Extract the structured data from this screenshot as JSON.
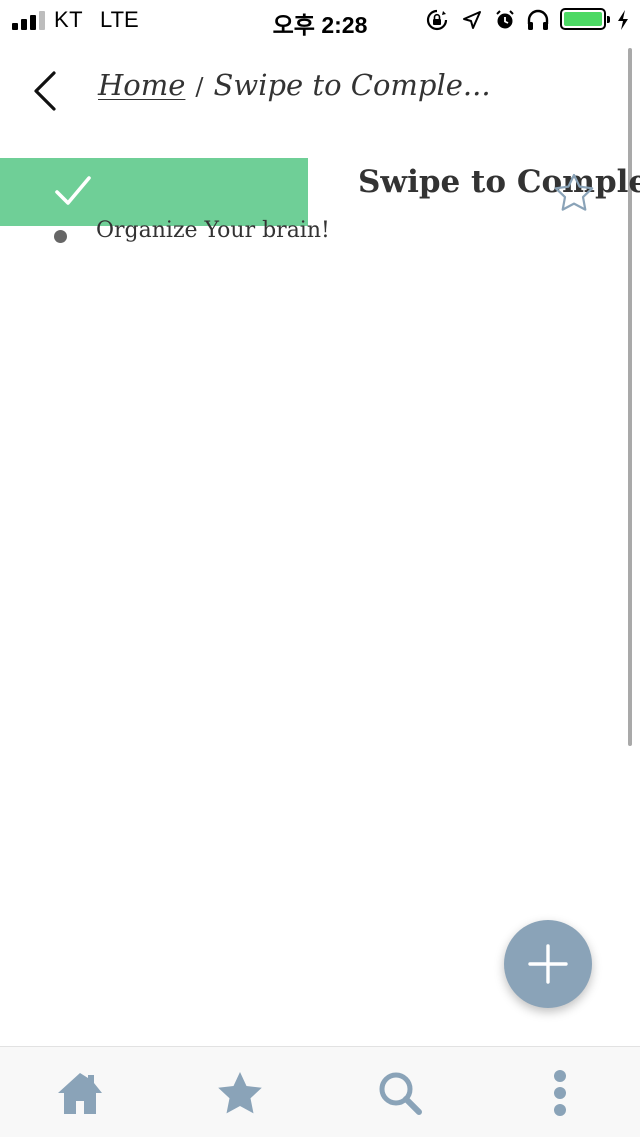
{
  "status_bar": {
    "carrier": "KT",
    "network": "LTE",
    "time": "오후 2:28",
    "battery_color": "#4cd964"
  },
  "header": {
    "back_icon": "chevron-left-icon",
    "breadcrumb": {
      "home": "Home",
      "separator": "/",
      "current": "Swipe to Comple..."
    }
  },
  "page": {
    "title": "Swipe to Complet",
    "star_icon": "star-outline-icon",
    "swipe_action_color": "#6fcf97",
    "items": [
      {
        "text": "Organize Your brain!"
      }
    ]
  },
  "fab": {
    "icon": "plus-icon",
    "color": "#8aa3b8"
  },
  "tab_bar": {
    "icon_color": "#8aa3b8",
    "tabs": [
      {
        "icon": "home-icon"
      },
      {
        "icon": "star-icon"
      },
      {
        "icon": "search-icon"
      },
      {
        "icon": "more-vertical-icon"
      }
    ]
  }
}
